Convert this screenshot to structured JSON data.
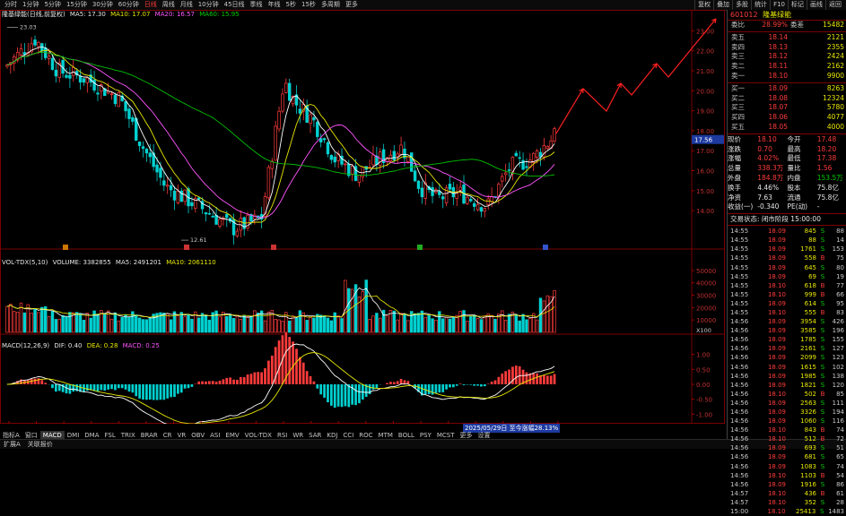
{
  "toolbar": {
    "periods": [
      "分时",
      "1分钟",
      "5分钟",
      "15分钟",
      "30分钟",
      "60分钟",
      "日线",
      "周线",
      "月线",
      "10分钟",
      "45日线",
      "季线",
      "年线",
      "5秒",
      "15秒",
      "多周期",
      "更多"
    ],
    "active_period": "日线",
    "right_buttons": [
      "复权",
      "叠加",
      "多股",
      "统计",
      "F10",
      "标记",
      "画线",
      "返回"
    ]
  },
  "chart": {
    "main_legend": {
      "title": "隆基绿能(日线,前复权)",
      "ma5": "MA5: 17.30",
      "ma10": "MA10: 17.07",
      "ma20": "MA20: 16.57",
      "ma60": "MA60: 15.95"
    },
    "price_axis": [
      "23.00",
      "22.00",
      "21.00",
      "20.00",
      "19.00",
      "18.00",
      "17.00",
      "16.00",
      "15.00",
      "14.00"
    ],
    "current_price_tag": "17.56",
    "high_label": "23.03",
    "low_label": "12.61",
    "event_markers": [
      "A",
      "B",
      "C",
      "D"
    ],
    "vol_legend": {
      "title": "VOL-TDX(5,10)",
      "volume": "VOLUME: 3382855",
      "ma5": "MA5: 2491201",
      "ma10": "MA10: 2061110"
    },
    "vol_axis": [
      "50000",
      "40000",
      "30000",
      "20000",
      "10000"
    ],
    "vol_unit": "X100",
    "macd_legend": {
      "title": "MACD(12,26,9)",
      "dif": "DIF: 0.40",
      "dea": "DEA: 0.28",
      "macd": "MACD: 0.25"
    },
    "macd_axis": [
      "1.00",
      "0.50",
      "0.00",
      "-0.50",
      "-1.00"
    ],
    "date_axis": [
      "2023年",
      "2",
      "3",
      "4",
      "5",
      "6",
      "7",
      "8",
      "9",
      "10",
      "11",
      "12",
      "2024年",
      "2",
      "3",
      "4",
      "5",
      "6",
      "7",
      "8",
      "9"
    ],
    "range_label": "2025/05/29日 至今涨幅28.13%",
    "axis_btn": "日线"
  },
  "indicator_tabs": [
    "指标A",
    "窗口",
    "MACD",
    "DMI",
    "DMA",
    "FSL",
    "TRIX",
    "BRAR",
    "CR",
    "VR",
    "OBV",
    "ASI",
    "EMV",
    "VOL-TDX",
    "RSI",
    "WR",
    "SAR",
    "KDJ",
    "CCI",
    "ROC",
    "MTM",
    "BOLL",
    "PSY",
    "MCST",
    "更多",
    "设置"
  ],
  "active_indicator": "MACD",
  "bottom_tabs": [
    "扩展A",
    "关联报价"
  ],
  "panel": {
    "code": "601012",
    "name": "隆基绿能",
    "weibi_label": "委比",
    "weibi": "28.99%",
    "weicha_label": "委差",
    "weicha": "15482",
    "asks": [
      {
        "label": "卖五",
        "price": "18.14",
        "vol": "2121"
      },
      {
        "label": "卖四",
        "price": "18.13",
        "vol": "2355"
      },
      {
        "label": "卖三",
        "price": "18.12",
        "vol": "2424"
      },
      {
        "label": "卖二",
        "price": "18.11",
        "vol": "2162"
      },
      {
        "label": "卖一",
        "price": "18.10",
        "vol": "9900"
      }
    ],
    "bids": [
      {
        "label": "买一",
        "price": "18.09",
        "vol": "8263"
      },
      {
        "label": "买二",
        "price": "18.08",
        "vol": "12324"
      },
      {
        "label": "买三",
        "price": "18.07",
        "vol": "5780"
      },
      {
        "label": "买四",
        "price": "18.06",
        "vol": "4077"
      },
      {
        "label": "买五",
        "price": "18.05",
        "vol": "4000"
      }
    ],
    "quote": [
      [
        "现价",
        "18.10",
        "今开",
        "17.48"
      ],
      [
        "涨跌",
        "0.70",
        "最高",
        "18.20"
      ],
      [
        "涨幅",
        "4.02%",
        "最低",
        "17.38"
      ],
      [
        "总量",
        "338.3万",
        "量比",
        "1.56"
      ],
      [
        "外盘",
        "184.8万",
        "内盘",
        "153.5万"
      ],
      [
        "换手",
        "4.46%",
        "股本",
        "75.8亿"
      ],
      [
        "净资",
        "7.63",
        "流通",
        "75.8亿"
      ],
      [
        "收益(一)",
        "-0.340",
        "PE(动)",
        "-"
      ]
    ],
    "status": "交易状态: 闭市阶段 15:00:00",
    "ticks": [
      [
        "14:55",
        "18.09",
        "845",
        "S",
        "88"
      ],
      [
        "14:55",
        "18.09",
        "88",
        "S",
        "14"
      ],
      [
        "14:55",
        "18.09",
        "1761",
        "S",
        "153"
      ],
      [
        "14:55",
        "18.09",
        "558",
        "B",
        "75"
      ],
      [
        "14:55",
        "18.09",
        "645",
        "S",
        "80"
      ],
      [
        "14:55",
        "18.09",
        "69",
        "S",
        "19"
      ],
      [
        "14:55",
        "18.10",
        "618",
        "B",
        "77"
      ],
      [
        "14:55",
        "18.10",
        "999",
        "B",
        "66"
      ],
      [
        "14:55",
        "18.09",
        "614",
        "S",
        "95"
      ],
      [
        "14:55",
        "18.10",
        "555",
        "B",
        "83"
      ],
      [
        "14:56",
        "18.09",
        "3954",
        "S",
        "426"
      ],
      [
        "14:56",
        "18.09",
        "3585",
        "S",
        "196"
      ],
      [
        "14:56",
        "18.09",
        "1785",
        "S",
        "155"
      ],
      [
        "14:56",
        "18.09",
        "2161",
        "S",
        "127"
      ],
      [
        "14:56",
        "18.09",
        "2099",
        "S",
        "123"
      ],
      [
        "14:56",
        "18.09",
        "1615",
        "S",
        "102"
      ],
      [
        "14:56",
        "18.09",
        "1985",
        "S",
        "138"
      ],
      [
        "14:56",
        "18.09",
        "1821",
        "S",
        "120"
      ],
      [
        "14:56",
        "18.10",
        "502",
        "B",
        "85"
      ],
      [
        "14:56",
        "18.09",
        "2563",
        "S",
        "111"
      ],
      [
        "14:56",
        "18.09",
        "3326",
        "S",
        "194"
      ],
      [
        "14:56",
        "18.09",
        "1060",
        "S",
        "116"
      ],
      [
        "14:56",
        "18.10",
        "843",
        "B",
        "74"
      ],
      [
        "14:56",
        "18.10",
        "512",
        "B",
        "72"
      ],
      [
        "14:56",
        "18.09",
        "693",
        "S",
        "51"
      ],
      [
        "14:56",
        "18.09",
        "681",
        "S",
        "65"
      ],
      [
        "14:56",
        "18.09",
        "1083",
        "S",
        "74"
      ],
      [
        "14:56",
        "18.10",
        "1103",
        "B",
        "54"
      ],
      [
        "14:56",
        "18.09",
        "1916",
        "S",
        "86"
      ],
      [
        "14:57",
        "18.10",
        "436",
        "B",
        "61"
      ],
      [
        "14:57",
        "18.10",
        "352",
        "S",
        "28"
      ],
      [
        "15:00",
        "18.10",
        "25413",
        "S",
        "1483"
      ]
    ]
  },
  "colors": {
    "up": "#ff3b3b",
    "down": "#00d0d0",
    "ma5": "#ffffff",
    "ma10": "#e8e800",
    "ma20": "#ff55ff",
    "ma60": "#00c000",
    "arrow": "#ff2020"
  }
}
